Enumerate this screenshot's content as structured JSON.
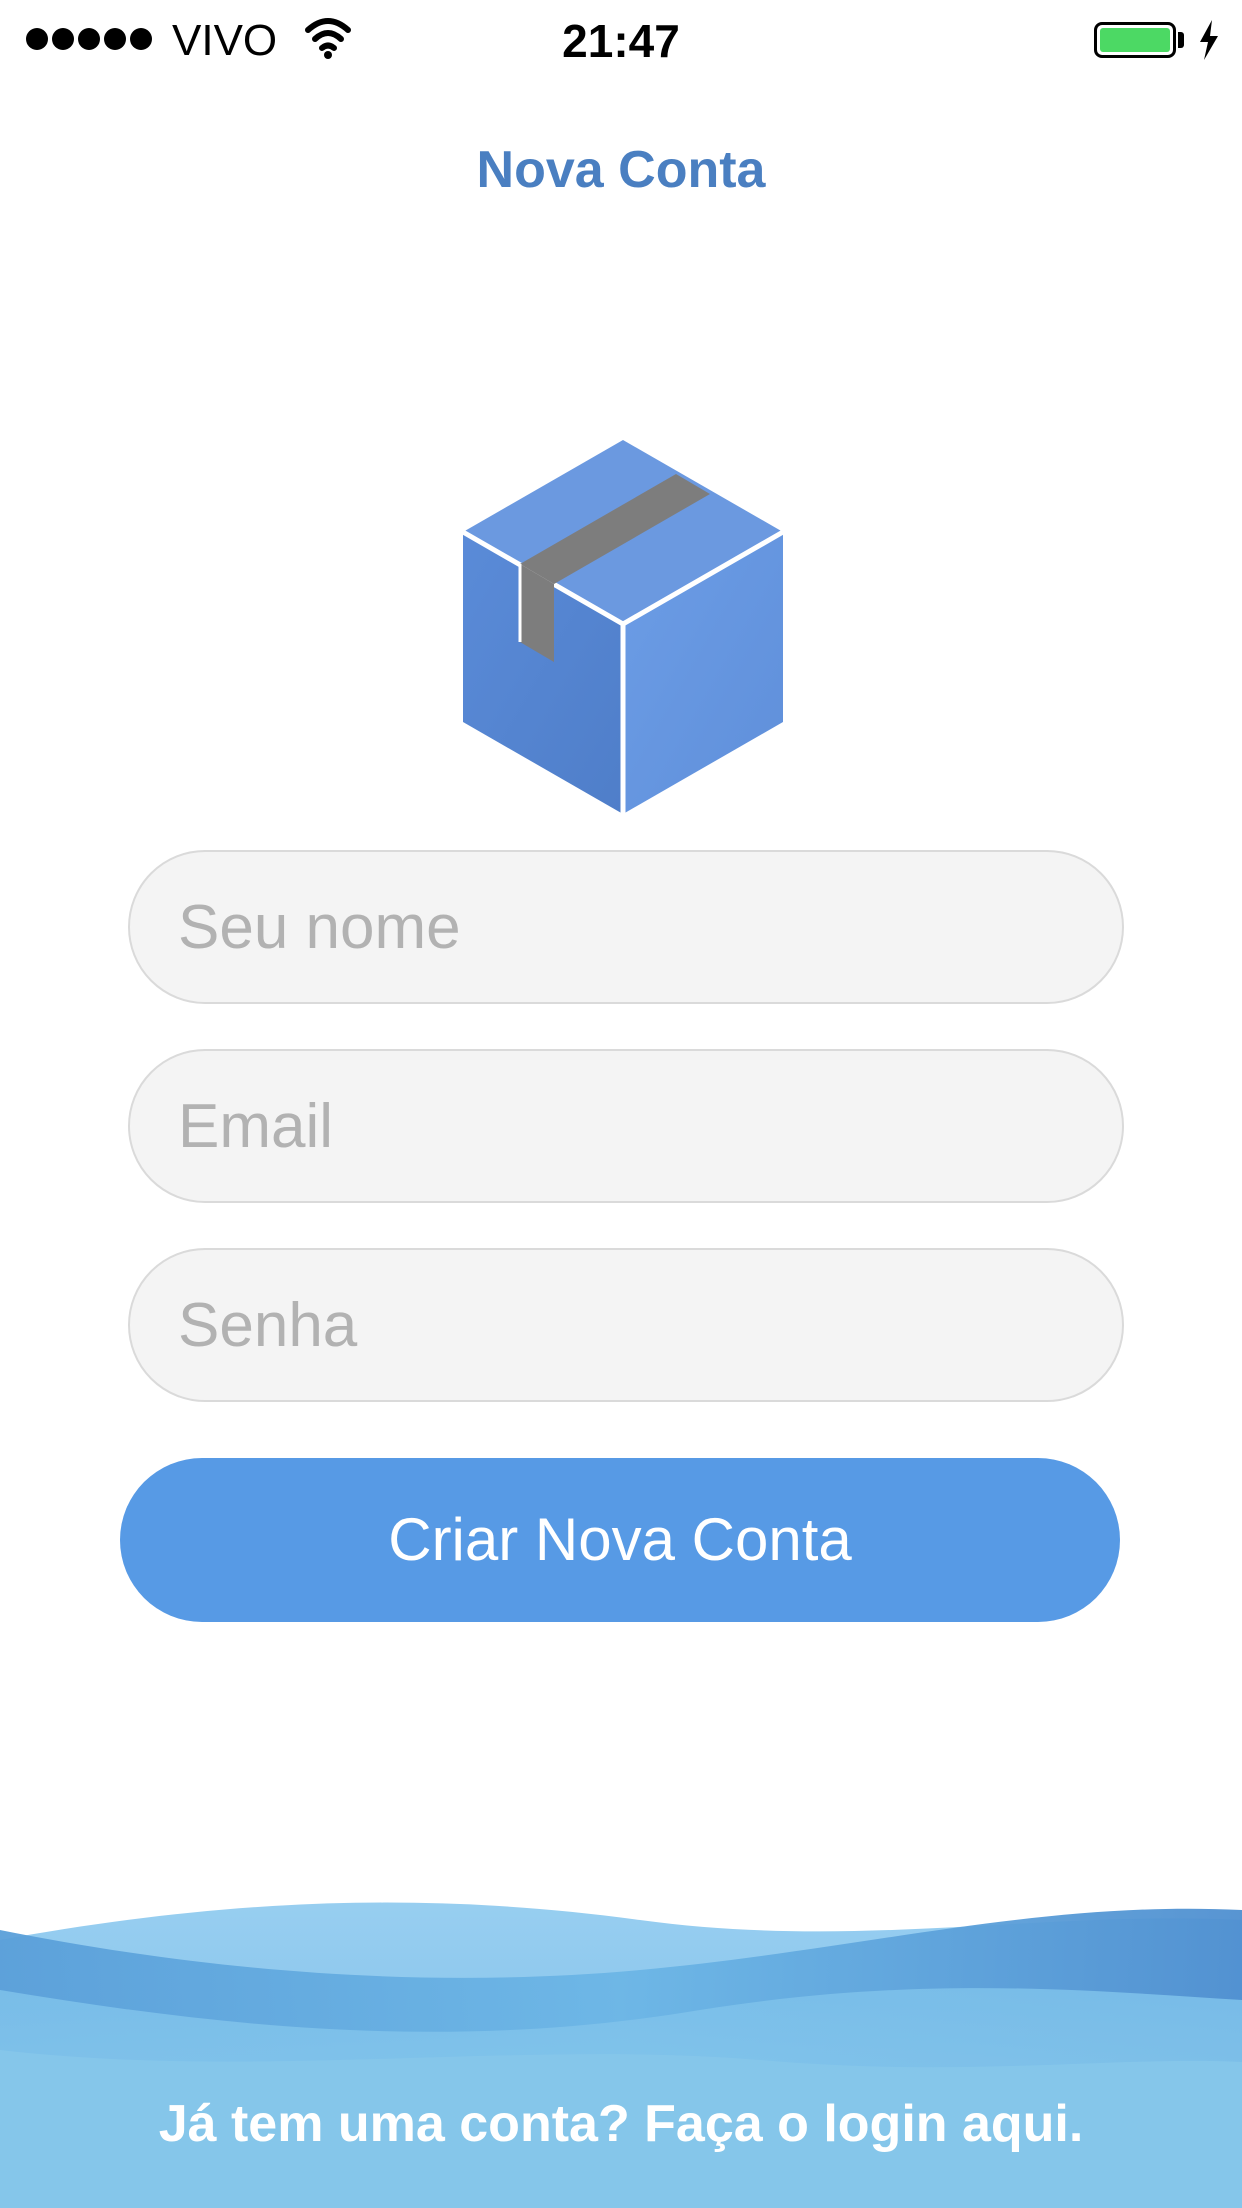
{
  "status_bar": {
    "carrier": "VIVO",
    "time": "21:47",
    "signal_bars": 5,
    "battery_level": 1.0,
    "charging": true,
    "battery_color": "#4cd964"
  },
  "nav": {
    "title": "Nova Conta"
  },
  "logo": {
    "icon": "package-box-icon",
    "color": "#5b8ad8"
  },
  "form": {
    "name_placeholder": "Seu nome",
    "email_placeholder": "Email",
    "password_placeholder": "Senha",
    "name_value": "",
    "email_value": "",
    "password_value": ""
  },
  "create_button": {
    "label": "Criar Nova Conta",
    "color": "#579ae5"
  },
  "footer": {
    "login_link": "Já tem uma conta? Faça o login aqui."
  },
  "colors": {
    "accent": "#4a7fc1",
    "wave": "#5fa8dc"
  }
}
